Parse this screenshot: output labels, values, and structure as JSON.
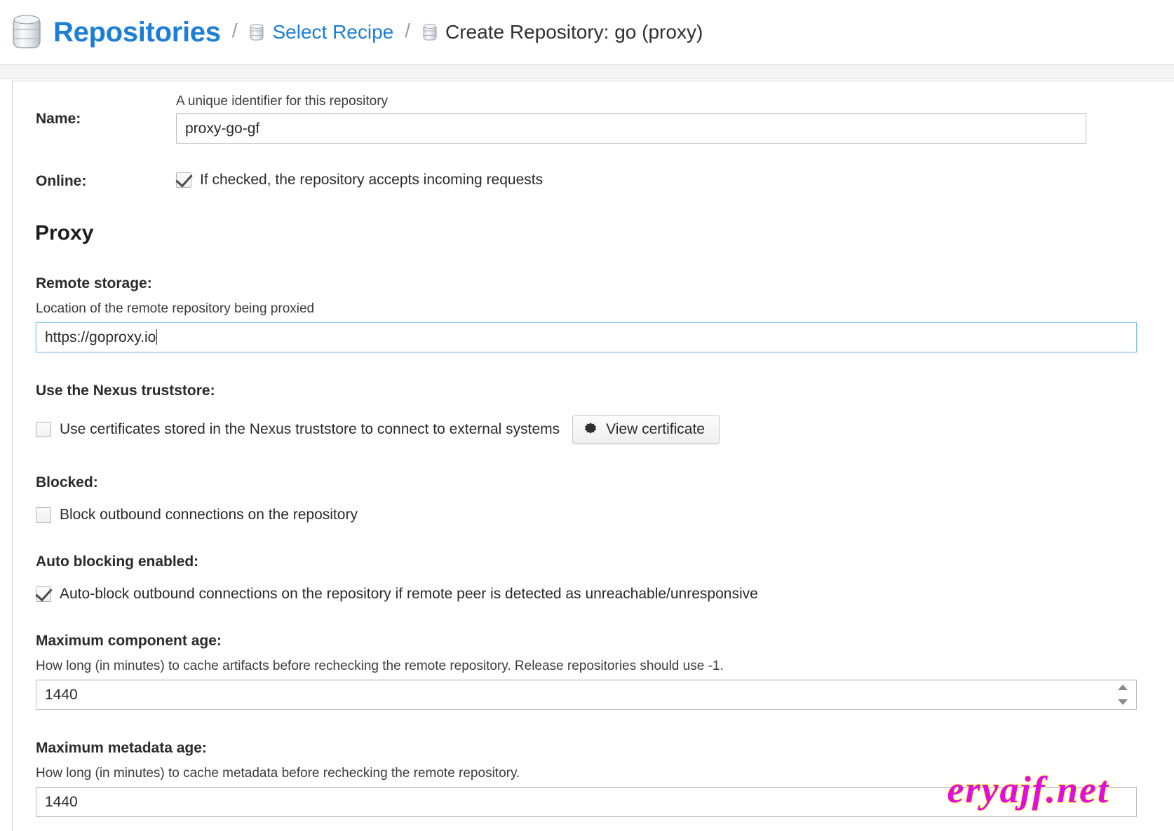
{
  "breadcrumb": {
    "root": {
      "label": "Repositories",
      "icon": "database-icon"
    },
    "separator": "/",
    "items": [
      {
        "label": "Select Recipe",
        "icon": "database-icon"
      },
      {
        "label": "Create Repository: go (proxy)",
        "icon": "database-icon"
      }
    ]
  },
  "form": {
    "name": {
      "label": "Name:",
      "hint": "A unique identifier for this repository",
      "value": "proxy-go-gf",
      "placeholder": ""
    },
    "online": {
      "label": "Online:",
      "checkbox_label": "If checked, the repository accepts incoming requests",
      "checked": true
    }
  },
  "proxy": {
    "section_title": "Proxy",
    "remote_storage": {
      "label": "Remote storage:",
      "hint": "Location of the remote repository being proxied",
      "value": "https://goproxy.io",
      "placeholder": "",
      "focused": true
    },
    "truststore": {
      "label": "Use the Nexus truststore:",
      "checkbox_label": "Use certificates stored in the Nexus truststore to connect to external systems",
      "checked": false,
      "button_label": "View certificate",
      "button_icon": "certificate-seal-icon"
    },
    "blocked": {
      "label": "Blocked:",
      "checkbox_label": "Block outbound connections on the repository",
      "checked": false
    },
    "auto_blocking": {
      "label": "Auto blocking enabled:",
      "checkbox_label": "Auto-block outbound connections on the repository if remote peer is detected as unreachable/unresponsive",
      "checked": true
    },
    "max_component_age": {
      "label": "Maximum component age:",
      "hint": "How long (in minutes) to cache artifacts before rechecking the remote repository. Release repositories should use -1.",
      "value": "1440",
      "placeholder": ""
    },
    "max_metadata_age": {
      "label": "Maximum metadata age:",
      "hint": "How long (in minutes) to cache metadata before rechecking the remote repository.",
      "value": "1440",
      "placeholder": ""
    }
  },
  "watermark": {
    "text": "eryajf.net"
  },
  "colors": {
    "link": "#1d7ed8",
    "text": "#2a2a2a",
    "focus_border": "#87c5ea",
    "watermark_fill": "#e20be2",
    "watermark_stroke": "#ffff4d"
  }
}
